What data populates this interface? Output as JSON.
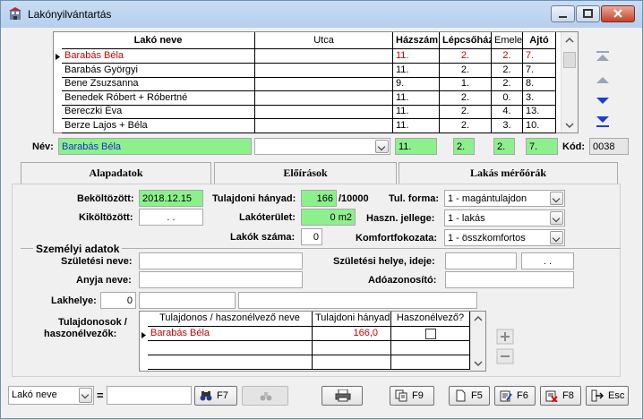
{
  "window": {
    "title": "Lakónyilvántartás"
  },
  "grid": {
    "headers": [
      "Lakó neve",
      "Utca",
      "Házszám",
      "Lépcsőház",
      "Emelet",
      "Ajtó"
    ],
    "rows": [
      {
        "name": "Barabás Béla",
        "utca": "",
        "hazszam": "11.",
        "lepcsohaz": "2.",
        "emelet": "2.",
        "ajto": "7.",
        "selected": true
      },
      {
        "name": "Barabás Györgyi",
        "utca": "",
        "hazszam": "11.",
        "lepcsohaz": "2.",
        "emelet": "2.",
        "ajto": "7."
      },
      {
        "name": "Bene Zsuzsanna",
        "utca": "",
        "hazszam": "9.",
        "lepcsohaz": "1.",
        "emelet": "2.",
        "ajto": "8."
      },
      {
        "name": "Benedek Róbert + Róbertné",
        "utca": "",
        "hazszam": "11.",
        "lepcsohaz": "2.",
        "emelet": "0.",
        "ajto": "3."
      },
      {
        "name": "Bereczki Éva",
        "utca": "",
        "hazszam": "11.",
        "lepcsohaz": "2.",
        "emelet": "4.",
        "ajto": "13."
      },
      {
        "name": "Berze Lajos + Béla",
        "utca": "",
        "hazszam": "11.",
        "lepcsohaz": "2.",
        "emelet": "3.",
        "ajto": "10."
      }
    ]
  },
  "record": {
    "nev_label": "Név:",
    "nev": "Barabás Béla",
    "hazszam": "11.",
    "lepcsohaz": "2.",
    "emelet": "2.",
    "ajto": "7.",
    "kod_label": "Kód:",
    "kod": "0038"
  },
  "tabs": [
    "Alapadatok",
    "Előírások",
    "Lakás mérőórák"
  ],
  "alap": {
    "bekoltozott_label": "Beköltözött:",
    "bekoltozott": "2018.12.15",
    "kikoltozott_label": "Kiköltözött:",
    "kikoltozott": ". .",
    "tulajdoni_label": "Tulajdoni hányad:",
    "tulajdoni": "166",
    "tulajdoni_unit": "/10000",
    "lakoterulet_label": "Lakóterület:",
    "lakoterulet": "0 m2",
    "lakok_label": "Lakók száma:",
    "lakok": "0",
    "tulforma_label": "Tul. forma:",
    "tulforma": "1 - magántulajdon",
    "haszn_label": "Haszn. jellege:",
    "haszn": "1 - lakás",
    "komfort_label": "Komfortfokozata:",
    "komfort": "1 - összkomfortos"
  },
  "szemelyi": {
    "section": "Személyi adatok",
    "szuletesi_nev_label": "Születési neve:",
    "anyja_label": "Anyja neve:",
    "szulhely_label": "Születési helye, ideje:",
    "szulido": ". .",
    "adoazon_label": "Adóazonosító:",
    "lakhely_label": "Lakhelye:",
    "lakhely_irsz": "0"
  },
  "tulajdonosok": {
    "label_line1": "Tulajdonosok /",
    "label_line2": "haszonélvezők:",
    "headers": [
      "Tulajdonos / haszonélvező neve",
      "Tulajdoni hányad",
      "Haszonélvező?"
    ],
    "rows": [
      {
        "name": "Barabás Béla",
        "hanyad": "166,0",
        "haszon": false
      }
    ]
  },
  "toolbar": {
    "search_field": "Lakó neve",
    "eq": "=",
    "f7": "F7",
    "f9": "F9",
    "f5": "F5",
    "f6": "F6",
    "f8": "F8",
    "esc": "Esc"
  }
}
